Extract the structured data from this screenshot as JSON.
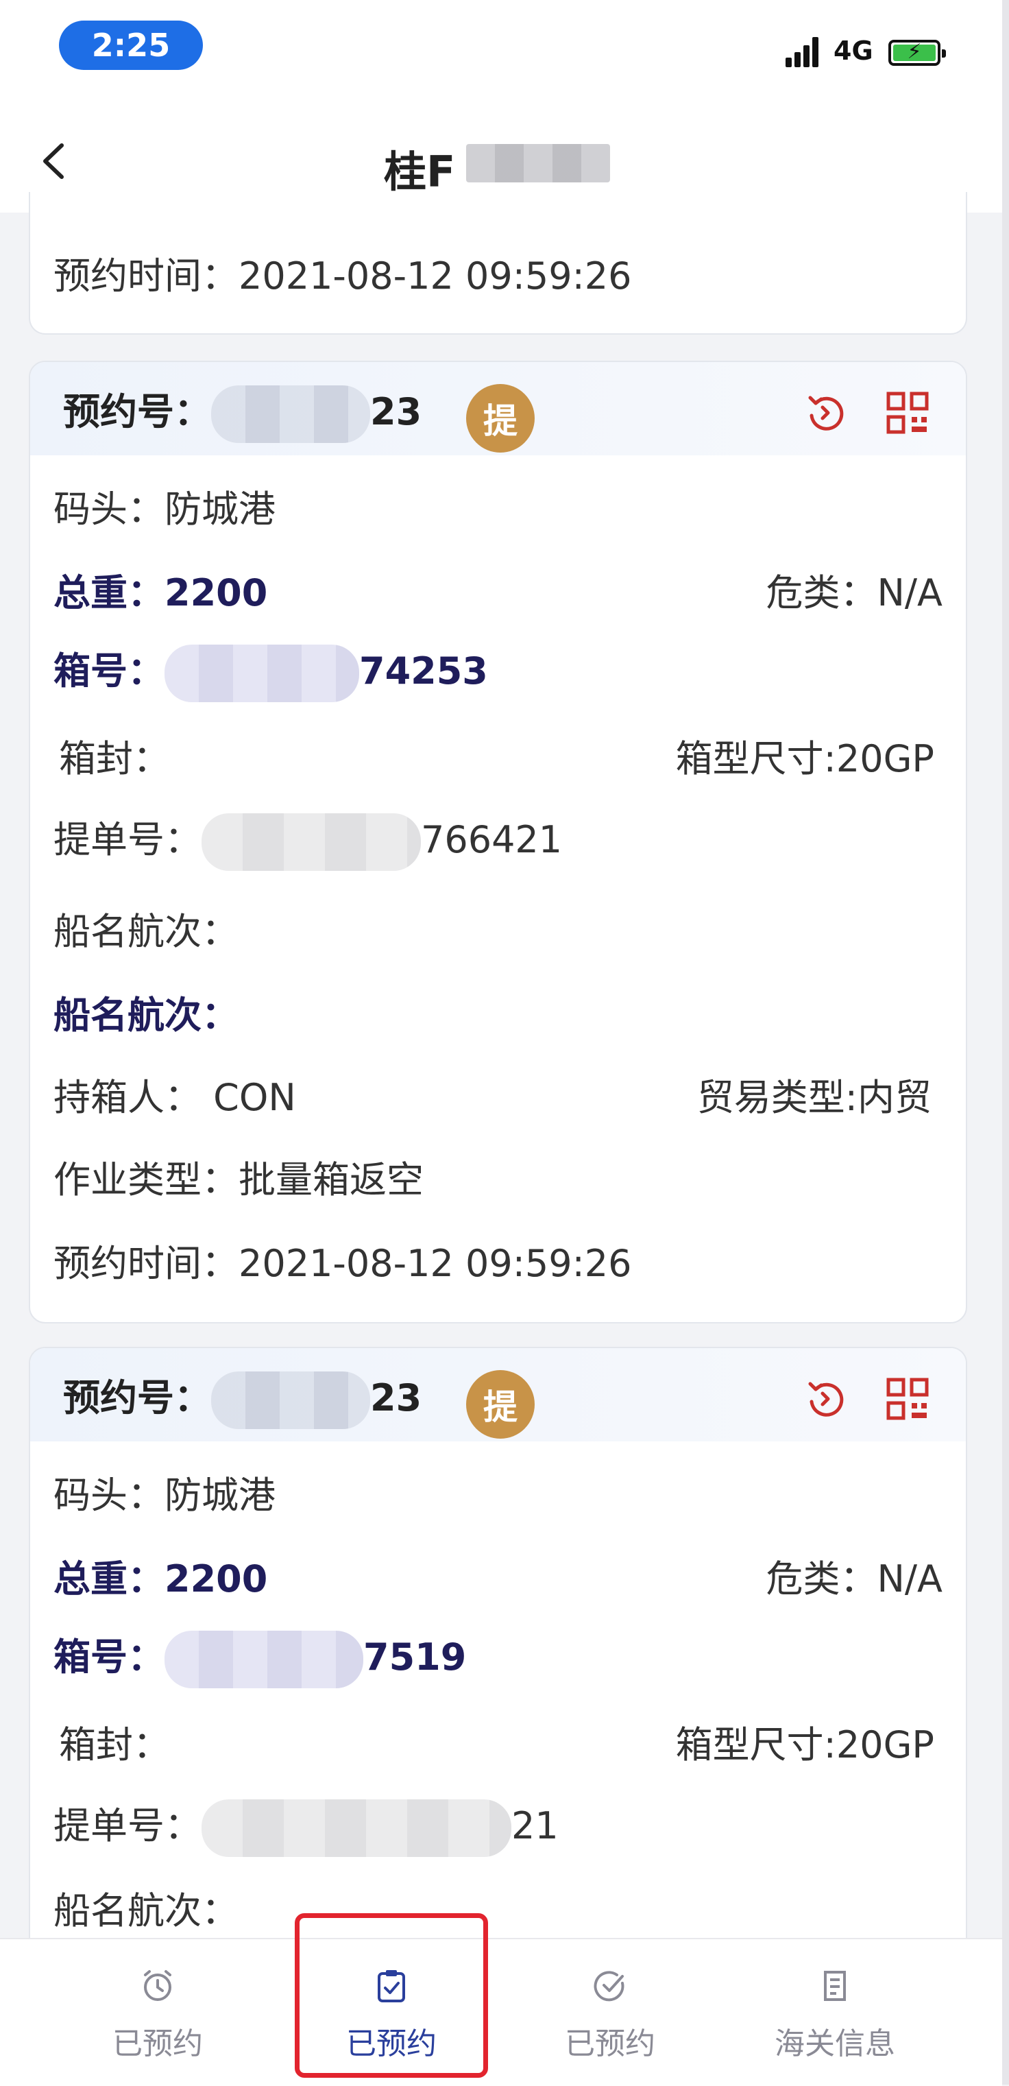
{
  "status_bar": {
    "time": "2:25",
    "network": "4G"
  },
  "header": {
    "title_visible": "桂F"
  },
  "top_card": {
    "time_label": "预约时间：",
    "time_value": "2021-08-12 09:59:26"
  },
  "cards": [
    {
      "reservation_label": "预约号：",
      "reservation_suffix": "23",
      "type_badge": "提",
      "terminal_label": "码头：",
      "terminal_value": "防城港",
      "weight_label": "总重：",
      "weight_value": "2200",
      "hazard_label": "危类：",
      "hazard_value": "N/A",
      "container_label": "箱号：",
      "container_suffix": "74253",
      "seal_label": "箱封：",
      "size_label": "箱型尺寸:",
      "size_value": "20GP",
      "bl_label": "提单号：",
      "bl_suffix": "766421",
      "vessel_label": "船名航次：",
      "vessel_label_bold": "船名航次：",
      "holder_label": "持箱人：",
      "holder_value": "CON",
      "trade_label": "贸易类型:",
      "trade_value": "内贸",
      "op_label": "作业类型：",
      "op_value": "批量箱返空",
      "time_label": "预约时间：",
      "time_value": "2021-08-12 09:59:26"
    },
    {
      "reservation_label": "预约号：",
      "reservation_suffix": "23",
      "type_badge": "提",
      "terminal_label": "码头：",
      "terminal_value": "防城港",
      "weight_label": "总重：",
      "weight_value": "2200",
      "hazard_label": "危类：",
      "hazard_value": "N/A",
      "container_label": "箱号：",
      "container_suffix": "7519",
      "seal_label": "箱封：",
      "size_label": "箱型尺寸:",
      "size_value": "20GP",
      "bl_label": "提单号：",
      "bl_suffix": "21",
      "vessel_label": "船名航次："
    }
  ],
  "tabbar": {
    "tabs": [
      {
        "label": "已预约",
        "icon": "alarm-clock-icon"
      },
      {
        "label": "已预约",
        "icon": "clipboard-check-icon",
        "active": true
      },
      {
        "label": "已预约",
        "icon": "check-circle-icon"
      },
      {
        "label": "海关信息",
        "icon": "document-icon"
      }
    ]
  },
  "colors": {
    "accent": "#2a3f9c",
    "badge": "#c89348",
    "highlight": "#e2242e",
    "icon_red": "#c9302c"
  }
}
